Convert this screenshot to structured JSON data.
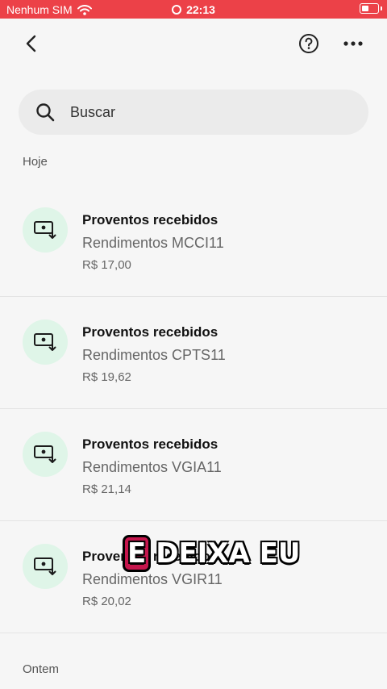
{
  "status_bar": {
    "carrier": "Nenhum SIM",
    "time": "22:13"
  },
  "search": {
    "placeholder": "Buscar"
  },
  "sections": {
    "today": "Hoje",
    "yesterday": "Ontem"
  },
  "transactions": [
    {
      "title": "Proventos recebidos",
      "subtitle": "Rendimentos MCCI11",
      "amount": "R$ 17,00"
    },
    {
      "title": "Proventos recebidos",
      "subtitle": "Rendimentos CPTS11",
      "amount": "R$ 19,62"
    },
    {
      "title": "Proventos recebidos",
      "subtitle": "Rendimentos VGIA11",
      "amount": "R$ 21,14"
    },
    {
      "title": "Proventos recebidos",
      "subtitle": "Rendimentos VGIR11",
      "amount": "R$ 20,02"
    }
  ],
  "overlay_caption": {
    "highlight": "E",
    "rest": "DEIXA EU"
  },
  "colors": {
    "status_bar": "#ec4148",
    "icon_badge": "#dff5e8",
    "icon": "#1b1b1b",
    "caption_highlight": "#c5164d"
  },
  "icons": {
    "back": "chevron-left-icon",
    "help": "help-circle-icon",
    "more": "more-horizontal-icon",
    "search": "search-icon",
    "transaction": "money-receive-icon"
  }
}
